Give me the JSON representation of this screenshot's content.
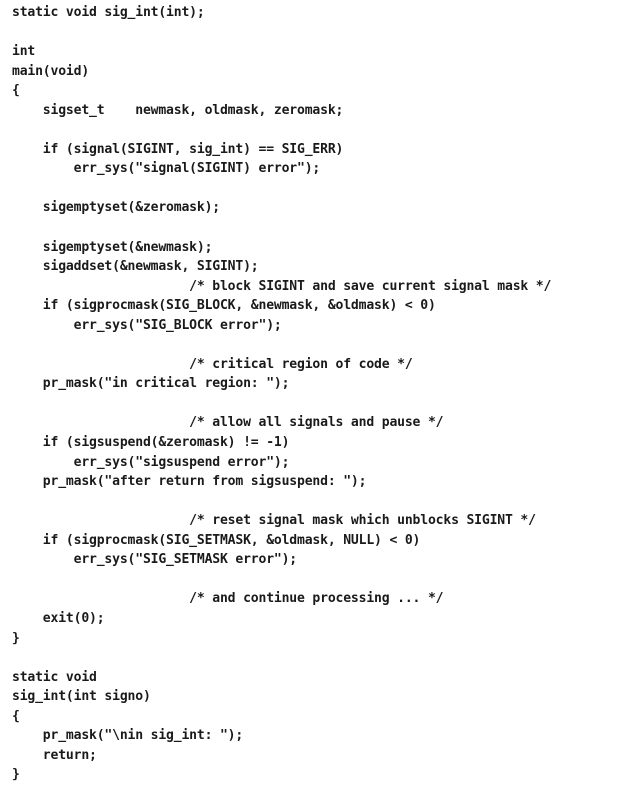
{
  "document": {
    "kind": "source-code-listing",
    "language": "C",
    "background_color": "#ffffff",
    "text_color": "#1a1a1a",
    "lines": [
      "static void sig_int(int);",
      "",
      "int",
      "main(void)",
      "{",
      "    sigset_t    newmask, oldmask, zeromask;",
      "",
      "    if (signal(SIGINT, sig_int) == SIG_ERR)",
      "        err_sys(\"signal(SIGINT) error\");",
      "",
      "    sigemptyset(&zeromask);",
      "",
      "    sigemptyset(&newmask);",
      "    sigaddset(&newmask, SIGINT);",
      "                       /* block SIGINT and save current signal mask */",
      "    if (sigprocmask(SIG_BLOCK, &newmask, &oldmask) < 0)",
      "        err_sys(\"SIG_BLOCK error\");",
      "",
      "                       /* critical region of code */",
      "    pr_mask(\"in critical region: \");",
      "",
      "                       /* allow all signals and pause */",
      "    if (sigsuspend(&zeromask) != -1)",
      "        err_sys(\"sigsuspend error\");",
      "    pr_mask(\"after return from sigsuspend: \");",
      "",
      "                       /* reset signal mask which unblocks SIGINT */",
      "    if (sigprocmask(SIG_SETMASK, &oldmask, NULL) < 0)",
      "        err_sys(\"SIG_SETMASK error\");",
      "",
      "                       /* and continue processing ... */",
      "    exit(0);",
      "}",
      "",
      "static void",
      "sig_int(int signo)",
      "{",
      "    pr_mask(\"\\nin sig_int: \");",
      "    return;",
      "}"
    ]
  }
}
